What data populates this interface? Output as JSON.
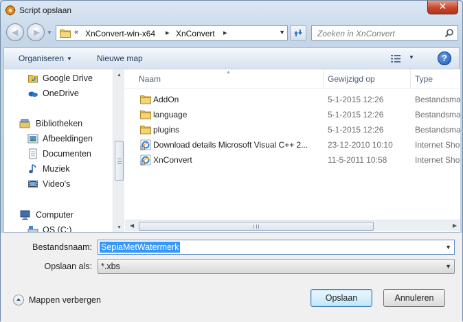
{
  "window": {
    "title": "Script opslaan",
    "close_label": "✕"
  },
  "address": {
    "prefix": "«",
    "segments": [
      "XnConvert-win-x64",
      "XnConvert"
    ],
    "separator": "▸"
  },
  "search": {
    "placeholder": "Zoeken in XnConvert"
  },
  "toolbar": {
    "organize_label": "Organiseren",
    "new_folder_label": "Nieuwe map",
    "help_label": "?"
  },
  "navpane": {
    "items": [
      {
        "label": "Google Drive",
        "icon": "google-drive-icon"
      },
      {
        "label": "OneDrive",
        "icon": "onedrive-icon"
      },
      {
        "label": "Bibliotheken",
        "icon": "libraries-icon"
      },
      {
        "label": "Afbeeldingen",
        "icon": "pictures-icon"
      },
      {
        "label": "Documenten",
        "icon": "documents-icon"
      },
      {
        "label": "Muziek",
        "icon": "music-icon"
      },
      {
        "label": "Video's",
        "icon": "videos-icon"
      },
      {
        "label": "Computer",
        "icon": "computer-icon"
      },
      {
        "label": "OS (C:)",
        "icon": "drive-icon"
      }
    ]
  },
  "filelist": {
    "columns": {
      "name": "Naam",
      "modified": "Gewijzigd op",
      "type": "Type"
    },
    "rows": [
      {
        "name": "AddOn",
        "modified": "5-1-2015 12:26",
        "type": "Bestandsmap",
        "icon": "folder-icon"
      },
      {
        "name": "language",
        "modified": "5-1-2015 12:26",
        "type": "Bestandsmap",
        "icon": "folder-icon"
      },
      {
        "name": "plugins",
        "modified": "5-1-2015 12:26",
        "type": "Bestandsmap",
        "icon": "folder-icon"
      },
      {
        "name": "Download details Microsoft Visual C++ 2...",
        "modified": "23-12-2010 10:10",
        "type": "Internet Shortcut",
        "icon": "internet-shortcut-icon"
      },
      {
        "name": "XnConvert",
        "modified": "11-5-2011 10:58",
        "type": "Internet Shortcut",
        "icon": "internet-shortcut-icon"
      }
    ]
  },
  "form": {
    "filename_label": "Bestandsnaam:",
    "filename_value": "SepiaMetWatermerk",
    "savetype_label": "Opslaan als:",
    "savetype_value": "*.xbs",
    "hide_folders_label": "Mappen verbergen",
    "save_label": "Opslaan",
    "cancel_label": "Annuleren"
  },
  "colors": {
    "selection": "#3399ff",
    "folder": "#e9c25a",
    "header_text": "#4c607a"
  }
}
